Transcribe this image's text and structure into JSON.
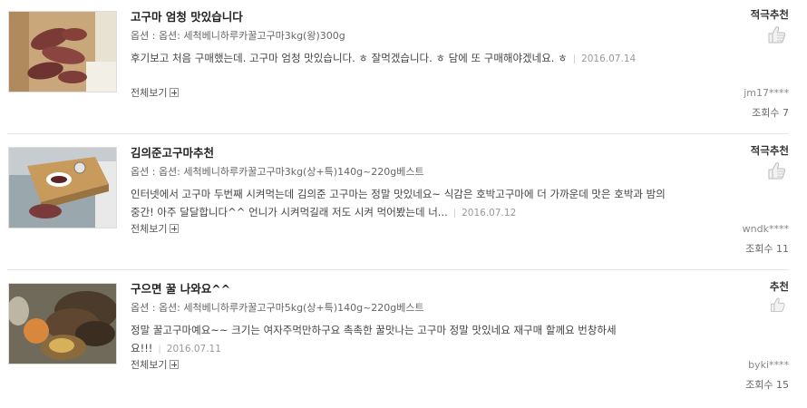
{
  "reviews": [
    {
      "title": "고구마 엄청 맛있습니다",
      "option": "옵션 : 옵션: 세척베니하루카꿀고구마3kg(왕)300g",
      "body": "후기보고 처음 구매했는데. 고구마 엄청 맛있습니다. ㅎ 잘먹겠습니다. ㅎ 담에 또 구매해야겠네요. ㅎ",
      "date": "2016.07.14",
      "more": "전체보기",
      "recommend": "적극추천",
      "user": "jm17****",
      "views": "조회수 7",
      "recommend_icon": "thumbs-up-double-icon"
    },
    {
      "title": "김의준고구마추천",
      "option": "옵션 : 옵션: 세척베니하루카꿀고구마3kg(상+특)140g~220g베스트",
      "body": "인터넷에서 고구마 두번째 시켜먹는데 김의준 고구마는 정말 맛있네요~ 식감은 호박고구마에 더 가까운데 맛은 호박과 밤의 중간! 아주 달달합니다^^ 언니가 시켜먹길래 저도 시켜 먹어봤는데 너...",
      "date": "2016.07.12",
      "more": "전체보기",
      "recommend": "적극추천",
      "user": "wndk****",
      "views": "조회수 11",
      "recommend_icon": "thumbs-up-double-icon"
    },
    {
      "title": "구으면 꿀 나와요^^",
      "option": "옵션 : 옵션: 세척베니하루카꿀고구마5kg(상+특)140g~220g베스트",
      "body": "정말 꿀고구마예요~~ 크기는 여자주먹만하구요 촉촉한 꿀맛나는 고구마 정말 맛있네요 재구매 할께요 번창하세요!!!",
      "date": "2016.07.11",
      "more": "전체보기",
      "recommend": "추천",
      "user": "byki****",
      "views": "조회수 15",
      "recommend_icon": "thumbs-up-icon"
    }
  ]
}
